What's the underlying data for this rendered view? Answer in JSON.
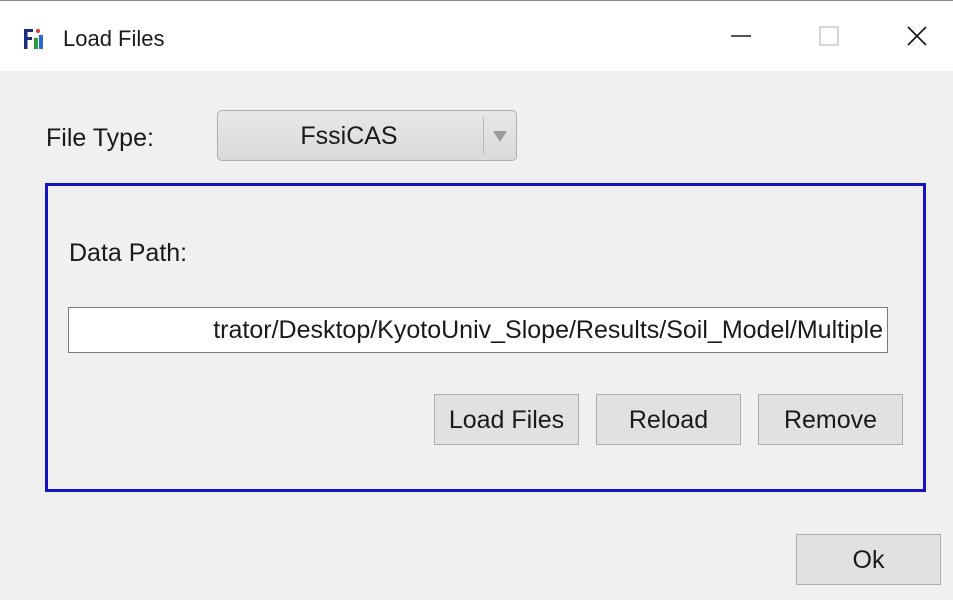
{
  "window": {
    "title": "Load Files",
    "app_icon": "fssicas-app-icon",
    "controls": {
      "minimize_icon": "minimize-icon",
      "maximize_icon": "maximize-icon",
      "close_icon": "close-icon"
    }
  },
  "file_type": {
    "label": "File Type:",
    "selected": "FssiCAS"
  },
  "data_group": {
    "border_color": "#1515c0",
    "path_label": "Data Path:",
    "path_value": "trator/Desktop/KyotoUniv_Slope/Results/Soil_Model/Multiple",
    "buttons": {
      "load_files": "Load Files",
      "reload": "Reload",
      "remove": "Remove"
    }
  },
  "footer": {
    "ok_label": "Ok"
  }
}
